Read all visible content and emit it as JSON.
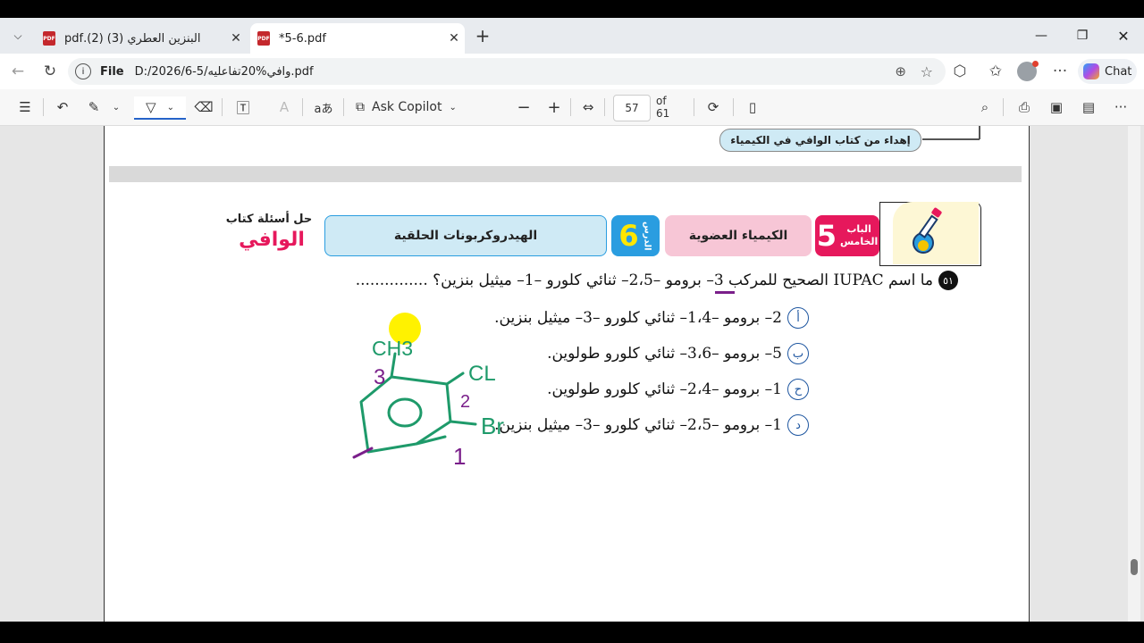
{
  "tabs": [
    {
      "title": "البنزين العطري (3) (2).pdf",
      "active": false
    },
    {
      "title": "*5-6.pdf",
      "active": true
    }
  ],
  "address": {
    "scheme_label": "File",
    "url": "D:/2026/6-5/وافي%20تفاعليه.pdf"
  },
  "browser": {
    "chat_label": "Chat"
  },
  "pdf_toolbar": {
    "ask_copilot": "Ask Copilot",
    "page_number": "57",
    "page_total": "of 61"
  },
  "page_top": {
    "banner_text": "إهداء من كتاب الوافي في الكيمياء"
  },
  "header": {
    "chapter_label": "الباب\nالخامس",
    "chapter_number": "5",
    "chapter_name": "الكيمياء العضوية",
    "lesson_label": "الدرس",
    "lesson_number": "6",
    "lesson_name": "الهيدروكربونات الحلقية",
    "book_caption": "حل أسئلة كتاب",
    "book_logo": "الوافي"
  },
  "question": {
    "number": "٥١",
    "text": "ما اسم IUPAC الصحيح للمركب 3– برومو –2،5– ثنائي كلورو –1– ميثيل بنزين؟ ...............",
    "options": [
      {
        "label": "أ",
        "text": "2– برومو –1،4– ثنائي كلورو –3– ميثيل بنزين."
      },
      {
        "label": "ب",
        "text": "5– برومو –3،6– ثنائي كلورو طولوين."
      },
      {
        "label": "ح",
        "text": "1– برومو –2،4– ثنائي كلورو طولوين."
      },
      {
        "label": "د",
        "text": "1– برومو –2،5– ثنائي كلورو –3– ميثيل بنزين."
      }
    ]
  },
  "drawing": {
    "labels": {
      "methyl": "CH3",
      "chloro": "CL",
      "bromo": "Br",
      "n3": "3",
      "n2": "2",
      "n1": "1"
    },
    "colors": {
      "structure": "#1e9a6a",
      "numbers": "#7a1f8a",
      "highlight": "#fff200"
    }
  },
  "colors": {
    "accent_pink": "#e6185c",
    "accent_blue": "#2a9de0",
    "banner_bg": "#cfeaf5"
  }
}
